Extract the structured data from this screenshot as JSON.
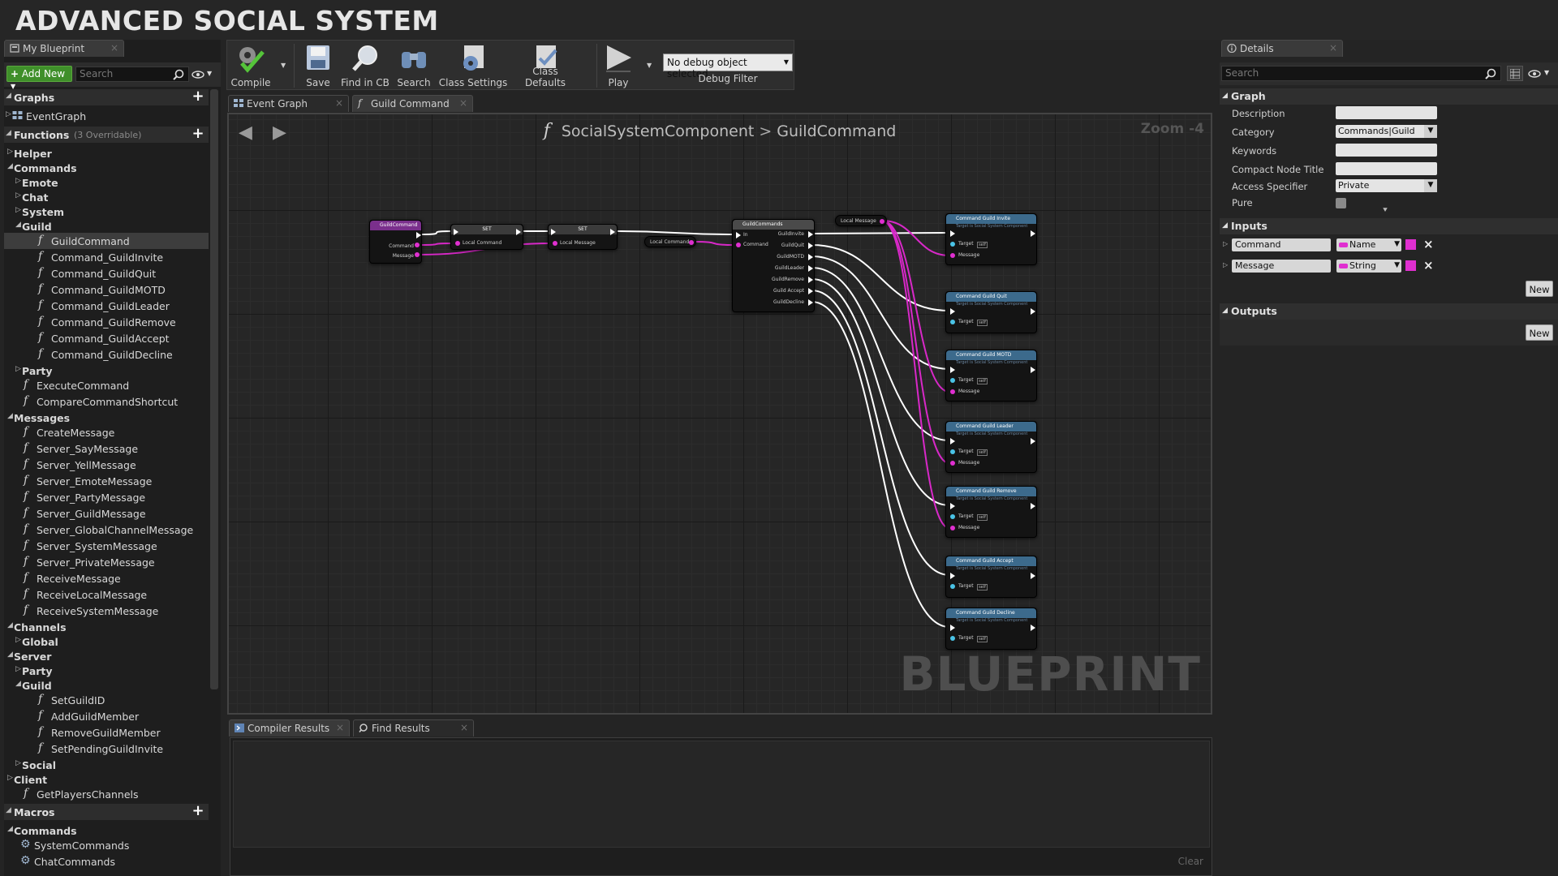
{
  "banner": {
    "title": "ADVANCED SOCIAL SYSTEM"
  },
  "left_panel": {
    "tab_label": "My Blueprint",
    "add_new_label": "Add New",
    "search_placeholder": "Search",
    "graphs_header": "Graphs",
    "event_graph": "EventGraph",
    "functions_header": "Functions",
    "functions_count": "(3 Overridable)",
    "macros_header": "Macros",
    "items": [
      {
        "type": "cat",
        "indent": 0,
        "label": "Helper",
        "open": false
      },
      {
        "type": "cat",
        "indent": 0,
        "label": "Commands",
        "open": true
      },
      {
        "type": "cat",
        "indent": 1,
        "label": "Emote",
        "open": false
      },
      {
        "type": "cat",
        "indent": 1,
        "label": "Chat",
        "open": false
      },
      {
        "type": "cat",
        "indent": 1,
        "label": "System",
        "open": false
      },
      {
        "type": "cat",
        "indent": 1,
        "label": "Guild",
        "open": true
      },
      {
        "type": "fn",
        "indent": 2,
        "label": "GuildCommand",
        "selected": true
      },
      {
        "type": "fn",
        "indent": 2,
        "label": "Command_GuildInvite"
      },
      {
        "type": "fn",
        "indent": 2,
        "label": "Command_GuildQuit"
      },
      {
        "type": "fn",
        "indent": 2,
        "label": "Command_GuildMOTD"
      },
      {
        "type": "fn",
        "indent": 2,
        "label": "Command_GuildLeader"
      },
      {
        "type": "fn",
        "indent": 2,
        "label": "Command_GuildRemove"
      },
      {
        "type": "fn",
        "indent": 2,
        "label": "Command_GuildAccept"
      },
      {
        "type": "fn",
        "indent": 2,
        "label": "Command_GuildDecline"
      },
      {
        "type": "cat",
        "indent": 1,
        "label": "Party",
        "open": false
      },
      {
        "type": "fn",
        "indent": 1,
        "label": "ExecuteCommand"
      },
      {
        "type": "fn",
        "indent": 1,
        "label": "CompareCommandShortcut"
      },
      {
        "type": "cat",
        "indent": 0,
        "label": "Messages",
        "open": true
      },
      {
        "type": "fn",
        "indent": 1,
        "label": "CreateMessage"
      },
      {
        "type": "fn",
        "indent": 1,
        "label": "Server_SayMessage"
      },
      {
        "type": "fn",
        "indent": 1,
        "label": "Server_YellMessage"
      },
      {
        "type": "fn",
        "indent": 1,
        "label": "Server_EmoteMessage"
      },
      {
        "type": "fn",
        "indent": 1,
        "label": "Server_PartyMessage"
      },
      {
        "type": "fn",
        "indent": 1,
        "label": "Server_GuildMessage"
      },
      {
        "type": "fn",
        "indent": 1,
        "label": "Server_GlobalChannelMessage"
      },
      {
        "type": "fn",
        "indent": 1,
        "label": "Server_SystemMessage"
      },
      {
        "type": "fn",
        "indent": 1,
        "label": "Server_PrivateMessage"
      },
      {
        "type": "fn",
        "indent": 1,
        "label": "ReceiveMessage"
      },
      {
        "type": "fn",
        "indent": 1,
        "label": "ReceiveLocalMessage"
      },
      {
        "type": "fn",
        "indent": 1,
        "label": "ReceiveSystemMessage"
      },
      {
        "type": "cat",
        "indent": 0,
        "label": "Channels",
        "open": true
      },
      {
        "type": "cat",
        "indent": 1,
        "label": "Global",
        "open": false
      },
      {
        "type": "cat",
        "indent": 0,
        "label": "Server",
        "open": true
      },
      {
        "type": "cat",
        "indent": 1,
        "label": "Party",
        "open": false
      },
      {
        "type": "cat",
        "indent": 1,
        "label": "Guild",
        "open": true
      },
      {
        "type": "fn",
        "indent": 2,
        "label": "SetGuildID"
      },
      {
        "type": "fn",
        "indent": 2,
        "label": "AddGuildMember"
      },
      {
        "type": "fn",
        "indent": 2,
        "label": "RemoveGuildMember"
      },
      {
        "type": "fn",
        "indent": 2,
        "label": "SetPendingGuildInvite"
      },
      {
        "type": "cat",
        "indent": 1,
        "label": "Social",
        "open": false
      },
      {
        "type": "cat",
        "indent": 0,
        "label": "Client",
        "open": false
      },
      {
        "type": "fn",
        "indent": 1,
        "label": "GetPlayersChannels"
      }
    ],
    "macros": [
      {
        "type": "cat",
        "indent": 0,
        "label": "Commands",
        "open": true
      },
      {
        "type": "macro",
        "indent": 1,
        "label": "SystemCommands"
      },
      {
        "type": "macro",
        "indent": 1,
        "label": "ChatCommands"
      }
    ]
  },
  "toolbar": {
    "compile": "Compile",
    "save": "Save",
    "find_in_cb": "Find in CB",
    "search": "Search",
    "class_settings": "Class Settings",
    "class_defaults": "Class Defaults",
    "play": "Play",
    "debug_select": "No debug object selected",
    "debug_filter": "Debug Filter"
  },
  "graph_tabs": {
    "event_graph": "Event Graph",
    "guild_command": "Guild Command"
  },
  "graph": {
    "breadcrumb_component": "SocialSystemComponent",
    "breadcrumb_function": "GuildCommand",
    "zoom": "Zoom -4",
    "watermark": "BLUEPRINT",
    "nodes": {
      "entry": {
        "title": "GuildCommand",
        "pins": [
          "Command",
          "Message"
        ]
      },
      "set1": {
        "title": "SET",
        "pin": "Local Command"
      },
      "set2": {
        "title": "SET",
        "pin": "Local Message"
      },
      "get_local_command": "Local Command",
      "get_local_message": "Local Message",
      "macro": {
        "title": "GuildCommands",
        "in_pins": [
          "In",
          "Command"
        ],
        "out_pins": [
          "GuildInvite",
          "GuildQuit",
          "GuildMOTD",
          "GuildLeader",
          "GuildRemove",
          "Guild Accept",
          "GuildDecline"
        ]
      },
      "calls": [
        {
          "title": "Command Guild Invite",
          "sub": "Target is Social System Component",
          "has_message": true
        },
        {
          "title": "Command Guild Quit",
          "sub": "Target is Social System Component",
          "has_message": false
        },
        {
          "title": "Command Guild MOTD",
          "sub": "Target is Social System Component",
          "has_message": true
        },
        {
          "title": "Command Guild Leader",
          "sub": "Target is Social System Component",
          "has_message": true
        },
        {
          "title": "Command Guild Remove",
          "sub": "Target is Social System Component",
          "has_message": true
        },
        {
          "title": "Command Guild Accept",
          "sub": "Target is Social System Component",
          "has_message": false
        },
        {
          "title": "Command Guild Decline",
          "sub": "Target is Social System Component",
          "has_message": false
        }
      ],
      "target_label": "Target",
      "self_label": "self",
      "message_label": "Message"
    }
  },
  "bottom": {
    "compiler_results": "Compiler Results",
    "find_results": "Find Results",
    "clear": "Clear"
  },
  "details": {
    "tab_label": "Details",
    "search_placeholder": "Search",
    "graph_section": "Graph",
    "fields": [
      {
        "label": "Description",
        "value": ""
      },
      {
        "label": "Category",
        "value": "Commands|Guild"
      },
      {
        "label": "Keywords",
        "value": ""
      },
      {
        "label": "Compact Node Title",
        "value": ""
      },
      {
        "label": "Access Specifier",
        "value": "Private"
      },
      {
        "label": "Pure",
        "value": ""
      }
    ],
    "inputs_section": "Inputs",
    "inputs": [
      {
        "name": "Command",
        "type": "Name"
      },
      {
        "name": "Message",
        "type": "String"
      }
    ],
    "outputs_section": "Outputs",
    "new_label": "New"
  },
  "colors": {
    "accent_green": "#3f8f2a",
    "string_pin": "#e02fd0",
    "exec_wire": "#ffffff",
    "call_header": "#3c6a8c"
  }
}
